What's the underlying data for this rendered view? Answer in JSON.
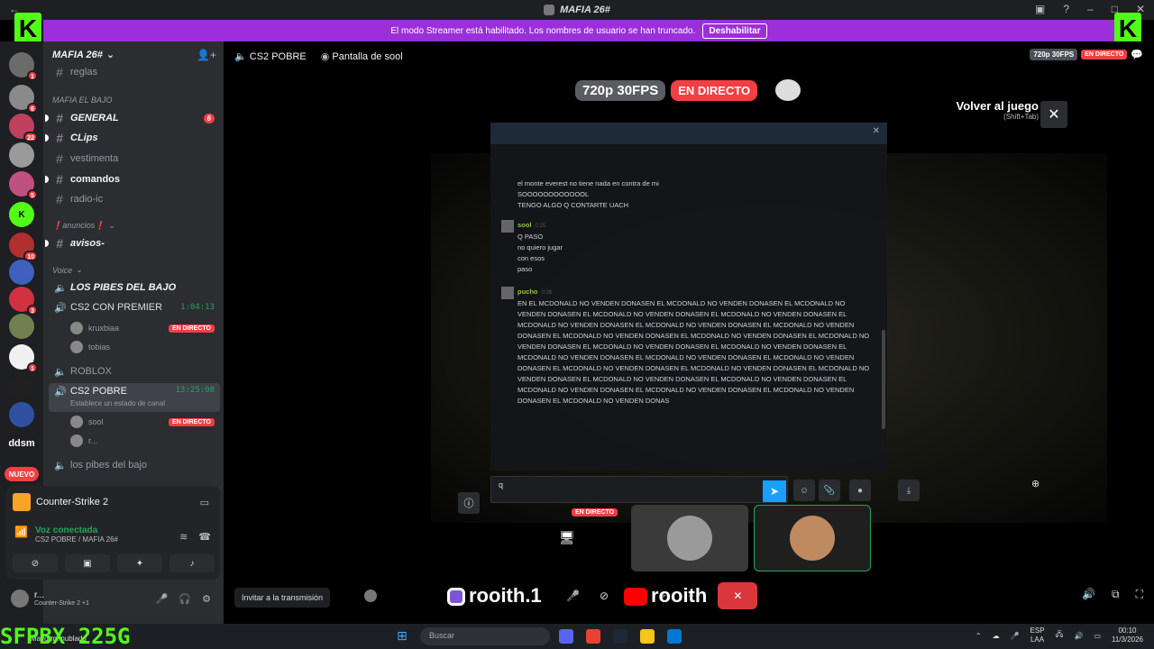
{
  "window": {
    "title": "MAFIA 26#"
  },
  "banner": {
    "text": "El modo Streamer está habilitado. Los nombres de usuario se han truncado.",
    "button": "Deshabilitar"
  },
  "server_rail": [
    {
      "label": "",
      "badge": "1",
      "color": "#6b6b6b"
    },
    {
      "label": "",
      "badge": "6",
      "color": "#8a8a8a"
    },
    {
      "label": "",
      "badge": "22",
      "color": "#c04060"
    },
    {
      "label": "",
      "badge": "",
      "color": "#9a9a9a"
    },
    {
      "label": "",
      "badge": "5",
      "color": "#c05080"
    },
    {
      "label": "K",
      "badge": "",
      "color": "#53fc18"
    },
    {
      "label": "",
      "badge": "10",
      "color": "#b03030"
    },
    {
      "label": "",
      "badge": "",
      "color": "#4060c0"
    },
    {
      "label": "",
      "badge": "3",
      "color": "#d03040"
    },
    {
      "label": "",
      "badge": "",
      "color": "#708050"
    },
    {
      "label": "",
      "badge": "1",
      "color": "#f0f0f0"
    },
    {
      "label": "",
      "badge": "",
      "color": "#202020"
    },
    {
      "label": "",
      "badge": "",
      "color": "#3050a0"
    },
    {
      "label": "ddsm",
      "badge": "",
      "color": "transparent"
    }
  ],
  "new_label": "NUEVO",
  "sidebar": {
    "server_name": "MAFIA 26#",
    "channels_top": [
      {
        "name": "reglas"
      }
    ],
    "cat_mafia": "MAFIA EL BAJO",
    "channels": [
      {
        "name": "GENERAL",
        "bold": true,
        "italic": true,
        "mention": "6"
      },
      {
        "name": "CLips",
        "bold": true,
        "italic": true,
        "mention": ""
      },
      {
        "name": "vestimenta",
        "bold": false,
        "italic": false,
        "mention": ""
      },
      {
        "name": "comandos",
        "bold": true,
        "italic": false,
        "mention": ""
      },
      {
        "name": "radio-ic",
        "bold": false,
        "italic": false,
        "mention": ""
      }
    ],
    "cat_anuncios": "❗anuncios❗",
    "avisos": "avisos-",
    "cat_voice": "Voice",
    "voice_los_pibes": "LOS PIBES DEL BAJO",
    "voice_cs2_premier": "CS2 CON PREMIER",
    "voice_cs2_premier_timer": "1:04:13",
    "premier_users": [
      {
        "name": "kruxbiaa",
        "live": true
      },
      {
        "name": "tobias",
        "live": false
      }
    ],
    "voice_roblox": "ROBLOX",
    "voice_cs2_pobre": "CS2 POBRE",
    "voice_cs2_pobre_timer": "13:25:08",
    "voice_cs2_pobre_status": "Establece un estado de canal",
    "pobre_users": [
      {
        "name": "sool",
        "live": true
      },
      {
        "name": "r...",
        "live": false
      }
    ],
    "voice_last": "los pibes del bajo",
    "live_label": "EN DIRECTO"
  },
  "game_panel": {
    "game": "Counter-Strike 2",
    "voice_connected": "Voz conectada",
    "voice_location": "CS2 POBRE / MAFIA 26#"
  },
  "user_panel": {
    "name": "r...",
    "status": "Counter-Strike 2 +1"
  },
  "stage": {
    "channel": "CS2 POBRE",
    "screen_share": "Pantalla de sool",
    "quality": "720p 30FPS",
    "live": "EN DIRECTO",
    "back_to_game": "Volver al juego",
    "back_shortcut": "(Shift+Tab)",
    "invite": "Invitar a la transmisión"
  },
  "chat": {
    "messages": [
      {
        "name": "",
        "time": "",
        "lines": [
          "el monte everest no tiene nada en contra de mi",
          "SOOOOOOOOOOOOL",
          "TENGO ALGO Q CONTARTE UACH"
        ]
      },
      {
        "name": "sool",
        "time": "0:25",
        "lines": [
          "Q PASO",
          "no quiero jugar",
          "con esos",
          "paso"
        ]
      },
      {
        "name": "pucho",
        "time": "0:26",
        "lines": [
          "EN EL MCDONALD NO VENDEN DONASEN EL MCDONALD NO VENDEN DONASEN EL MCDONALD NO VENDEN DONASEN EL MCDONALD NO VENDEN DONASEN EL MCDONALD NO VENDEN DONASEN EL MCDONALD NO VENDEN DONASEN EL MCDONALD NO VENDEN DONASEN EL MCDONALD NO VENDEN DONASEN EL MCDONALD NO VENDEN DONASEN EL MCDONALD NO VENDEN DONASEN EL MCDONALD NO VENDEN DONASEN EL MCDONALD NO VENDEN DONASEN EL MCDONALD NO VENDEN DONASEN EL MCDONALD NO VENDEN DONASEN EL MCDONALD NO VENDEN DONASEN EL MCDONALD NO VENDEN DONASEN EL MCDONALD NO VENDEN DONASEN EL MCDONALD NO VENDEN DONASEN EL MCDONALD NO VENDEN DONASEN EL MCDONALD NO VENDEN DONASEN EL MCDONALD NO VENDEN DONASEN EL MCDONALD NO VENDEN DONASEN EL MCDONALD NO VENDEN DONASEN EL MCDONALD NO VENDEN DONASEN EL MCDONALD NO VENDEN DONAS"
        ]
      }
    ],
    "input_value": "q"
  },
  "overlay": {
    "channel_name": "rooith.1",
    "yt_name": "rooith",
    "channel_name_2": "rooith",
    "yt_name_2": "rooith1",
    "spec": "SFPBX 225G",
    "weather": "Mayorm. nublado"
  },
  "taskbar": {
    "search": "Buscar",
    "lang": "ESP",
    "lang2": "LAA",
    "time": "00:10",
    "date": "11/3/2026"
  },
  "colors": {
    "accent": "#5865f2",
    "live": "#f23f43",
    "voice": "#23a55a",
    "banner": "#9b2fd9",
    "kick": "#53fc18"
  }
}
